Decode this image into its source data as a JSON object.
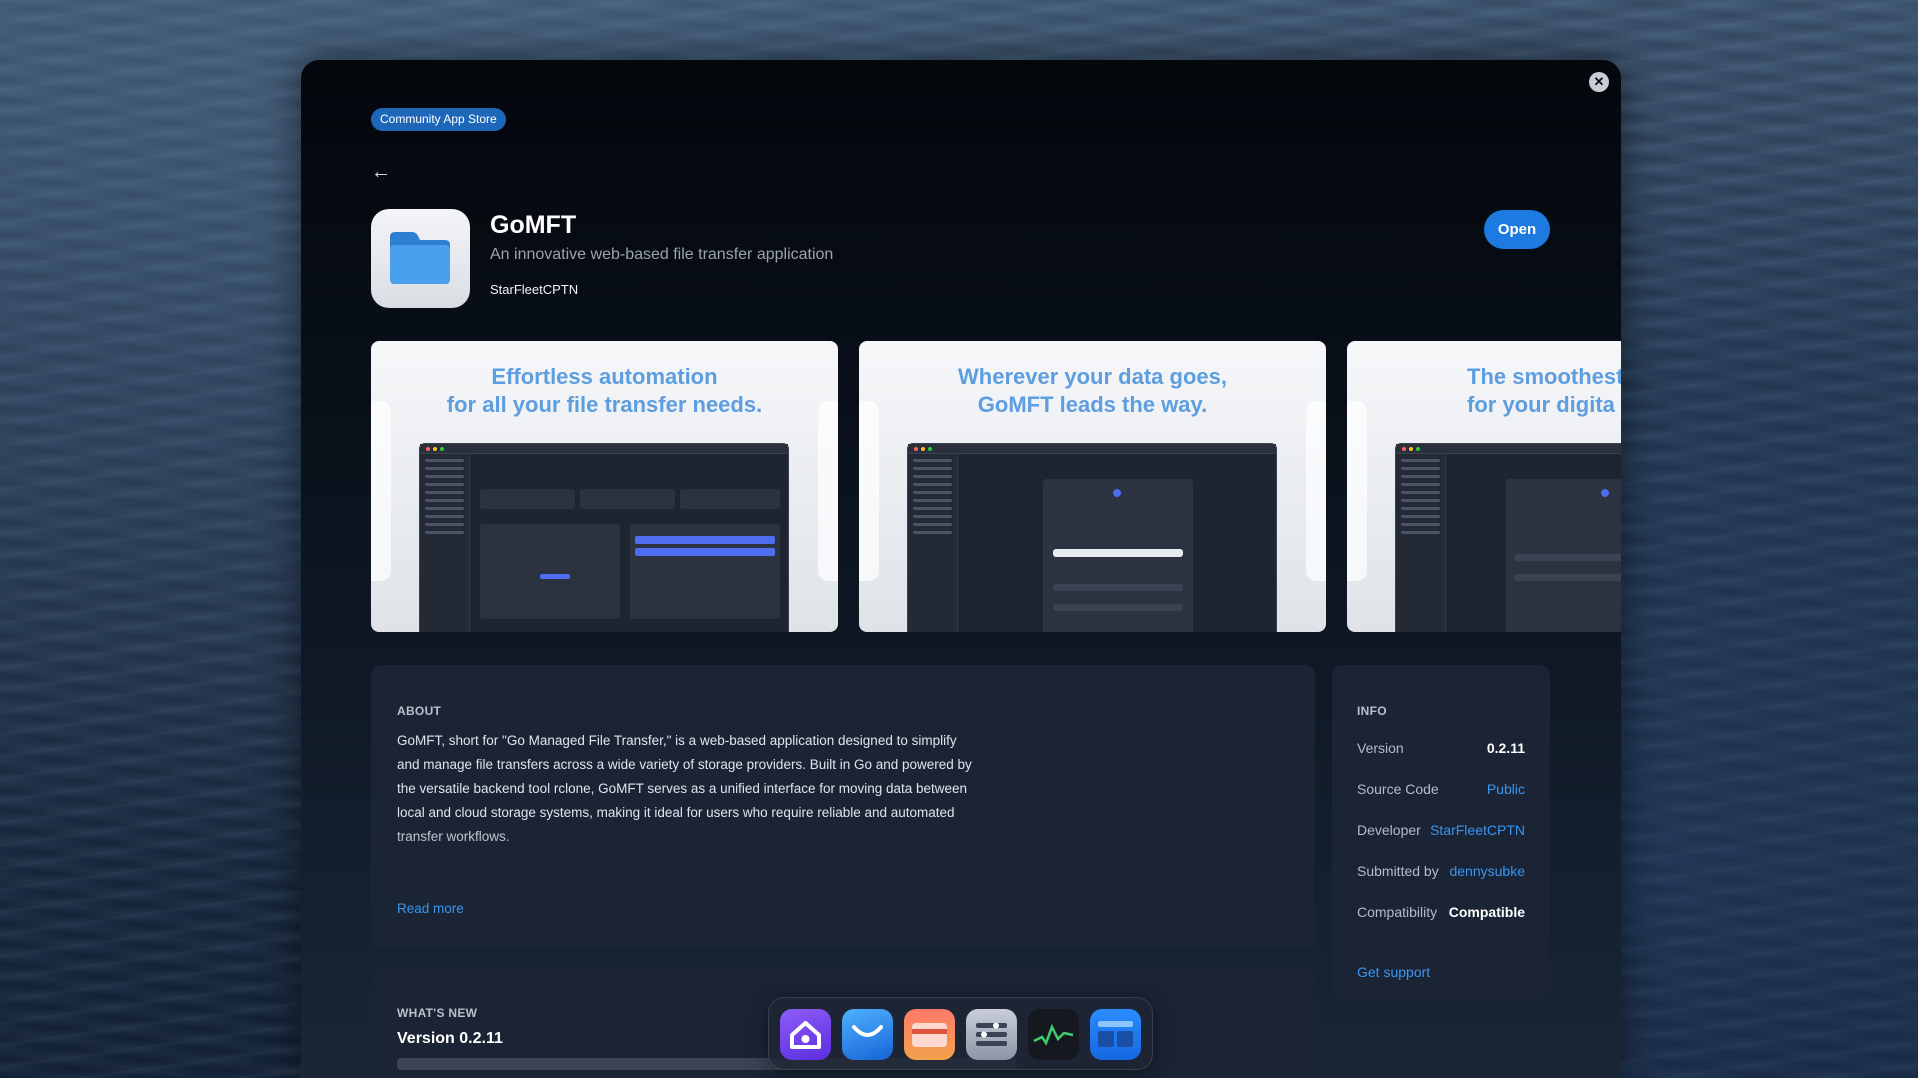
{
  "modal": {
    "badge": "Community App Store",
    "close_icon": "✕",
    "back_icon": "←"
  },
  "app": {
    "name": "GoMFT",
    "tagline": "An innovative web-based file transfer application",
    "developer": "StarFleetCPTN",
    "open_label": "Open",
    "icon": "folder-icon"
  },
  "screenshots": [
    {
      "caption": "Effortless automation\nfor all your file transfer needs."
    },
    {
      "caption": "Wherever your data goes,\nGoMFT leads the way."
    },
    {
      "caption": "The smoothest\nfor your digita"
    }
  ],
  "about": {
    "heading": "ABOUT",
    "text": "GoMFT, short for \"Go Managed File Transfer,\" is a web-based application designed to simplify and manage file transfers across a wide variety of storage providers. Built in Go and powered by the versatile backend tool rclone, GoMFT serves as a unified interface for moving data between local and cloud storage systems, making it ideal for users who require reliable and automated transfer workflows.",
    "read_more": "Read more"
  },
  "info": {
    "heading": "INFO",
    "rows": [
      {
        "key": "Version",
        "value": "0.2.11"
      },
      {
        "key": "Source Code",
        "value": "Public"
      },
      {
        "key": "Developer",
        "value": "StarFleetCPTN"
      },
      {
        "key": "Submitted by",
        "value": "dennysubke"
      },
      {
        "key": "Compatibility",
        "value": "Compatible"
      }
    ],
    "get_support": "Get support"
  },
  "whats_new": {
    "heading": "WHAT'S NEW",
    "version": "Version 0.2.11"
  },
  "dock": {
    "items": [
      "home-app-icon",
      "mail-app-icon",
      "wallet-app-icon",
      "settings-app-icon",
      "activity-monitor-icon",
      "dashboard-app-icon"
    ]
  },
  "colors": {
    "accent": "#1c7ae0",
    "link": "#3b95f0",
    "caption_blue": "#5d9ee0"
  }
}
